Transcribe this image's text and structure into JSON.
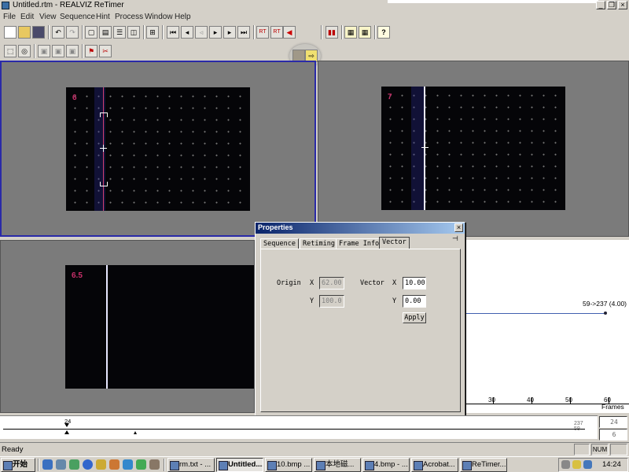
{
  "window": {
    "title": "Untitled.rtm - REALVIZ ReTimer",
    "min": "_",
    "max": "❐",
    "close": "×"
  },
  "menu": [
    "File",
    "Edit",
    "View",
    "Sequence",
    "Hint",
    "Process",
    "Window",
    "Help"
  ],
  "toolbar": {
    "row1": [
      "new-icon",
      "open-icon",
      "save-icon",
      "undo-icon",
      "redo-icon",
      "layout-single-icon",
      "layout-split-icon",
      "layout-four-icon",
      "layout-dual-icon",
      "grid-icon",
      "first-frame-icon",
      "prev-frame-icon",
      "play-back-icon",
      "play-icon",
      "next-frame-icon",
      "last-frame-icon",
      "rt-left-icon",
      "rt-right-icon",
      "marker-icon",
      "film-icon",
      "arrow-right-icon",
      "film-edit-icon",
      "properties-icon",
      "sequence-icon",
      "help-icon"
    ],
    "rt_label": "RT",
    "help_glyph": "?",
    "row2": [
      "select-icon",
      "target-icon",
      "view-a-icon",
      "view-b-icon",
      "view-c-icon",
      "tool-flag-icon",
      "tool-cut-icon"
    ]
  },
  "viewports": {
    "top_left_frame": "6",
    "top_right_frame": "7",
    "bottom_left_frame": "6.5"
  },
  "graph": {
    "point_label": "59->237 (4.00)",
    "ticks": [
      "30",
      "40",
      "50",
      "60"
    ],
    "unit": "Frames"
  },
  "properties": {
    "title": "Properties",
    "close": "×",
    "tabs": [
      "Sequence",
      "Retiming",
      "Frame Info",
      "Vector"
    ],
    "active_tab": "Vector",
    "origin_label": "Origin",
    "vector_label": "Vector",
    "x_label": "X",
    "y_label": "Y",
    "origin_x": "62.00",
    "origin_y": "100.0",
    "vector_x": "10.00",
    "vector_y": "0.00",
    "apply": "Apply"
  },
  "timeline": {
    "current": "24",
    "end": "237",
    "end2": "59",
    "field_top": "24",
    "field_bottom": "6"
  },
  "status": {
    "text": "Ready",
    "num": "NUM"
  },
  "taskbar": {
    "start": "开始",
    "tasks": [
      "rm.txt - ...",
      "Untitled....",
      "10.bmp ...",
      "本地磁...",
      "4.bmp - ...",
      "Acrobat...",
      "ReTimer..."
    ],
    "active_task": "Untitled....",
    "clock": "14:24"
  }
}
